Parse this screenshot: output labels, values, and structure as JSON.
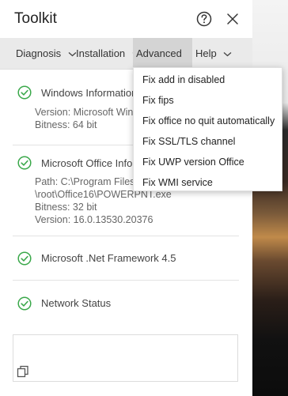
{
  "window": {
    "title": "Toolkit"
  },
  "menu": {
    "items": [
      {
        "label": "Diagnosis"
      },
      {
        "label": "Installation"
      },
      {
        "label": "Advanced"
      },
      {
        "label": "Help"
      }
    ]
  },
  "dropdown": {
    "items": [
      {
        "label": "Fix add in disabled"
      },
      {
        "label": "Fix fips"
      },
      {
        "label": "Fix office no quit automatically"
      },
      {
        "label": "Fix SSL/TLS channel"
      },
      {
        "label": "Fix UWP version Office"
      },
      {
        "label": "Fix WMI service"
      }
    ]
  },
  "sections": [
    {
      "title": "Windows Information",
      "lines": [
        "Version: Microsoft Windows 10",
        "Bitness: 64 bit"
      ]
    },
    {
      "title": "Microsoft Office Information",
      "lines": [
        "Path: C:\\Program Files\\Microsoft Office",
        "\\root\\Office16\\POWERPNT.exe",
        "Bitness: 32 bit",
        "Version: 16.0.13530.20376"
      ]
    },
    {
      "title": "Microsoft .Net Framework 4.5",
      "lines": []
    },
    {
      "title": "Network Status",
      "lines": []
    }
  ],
  "colors": {
    "check": "#3aa84a",
    "menu_bg": "#eaeaea",
    "menu_active": "#d4d4d4"
  }
}
